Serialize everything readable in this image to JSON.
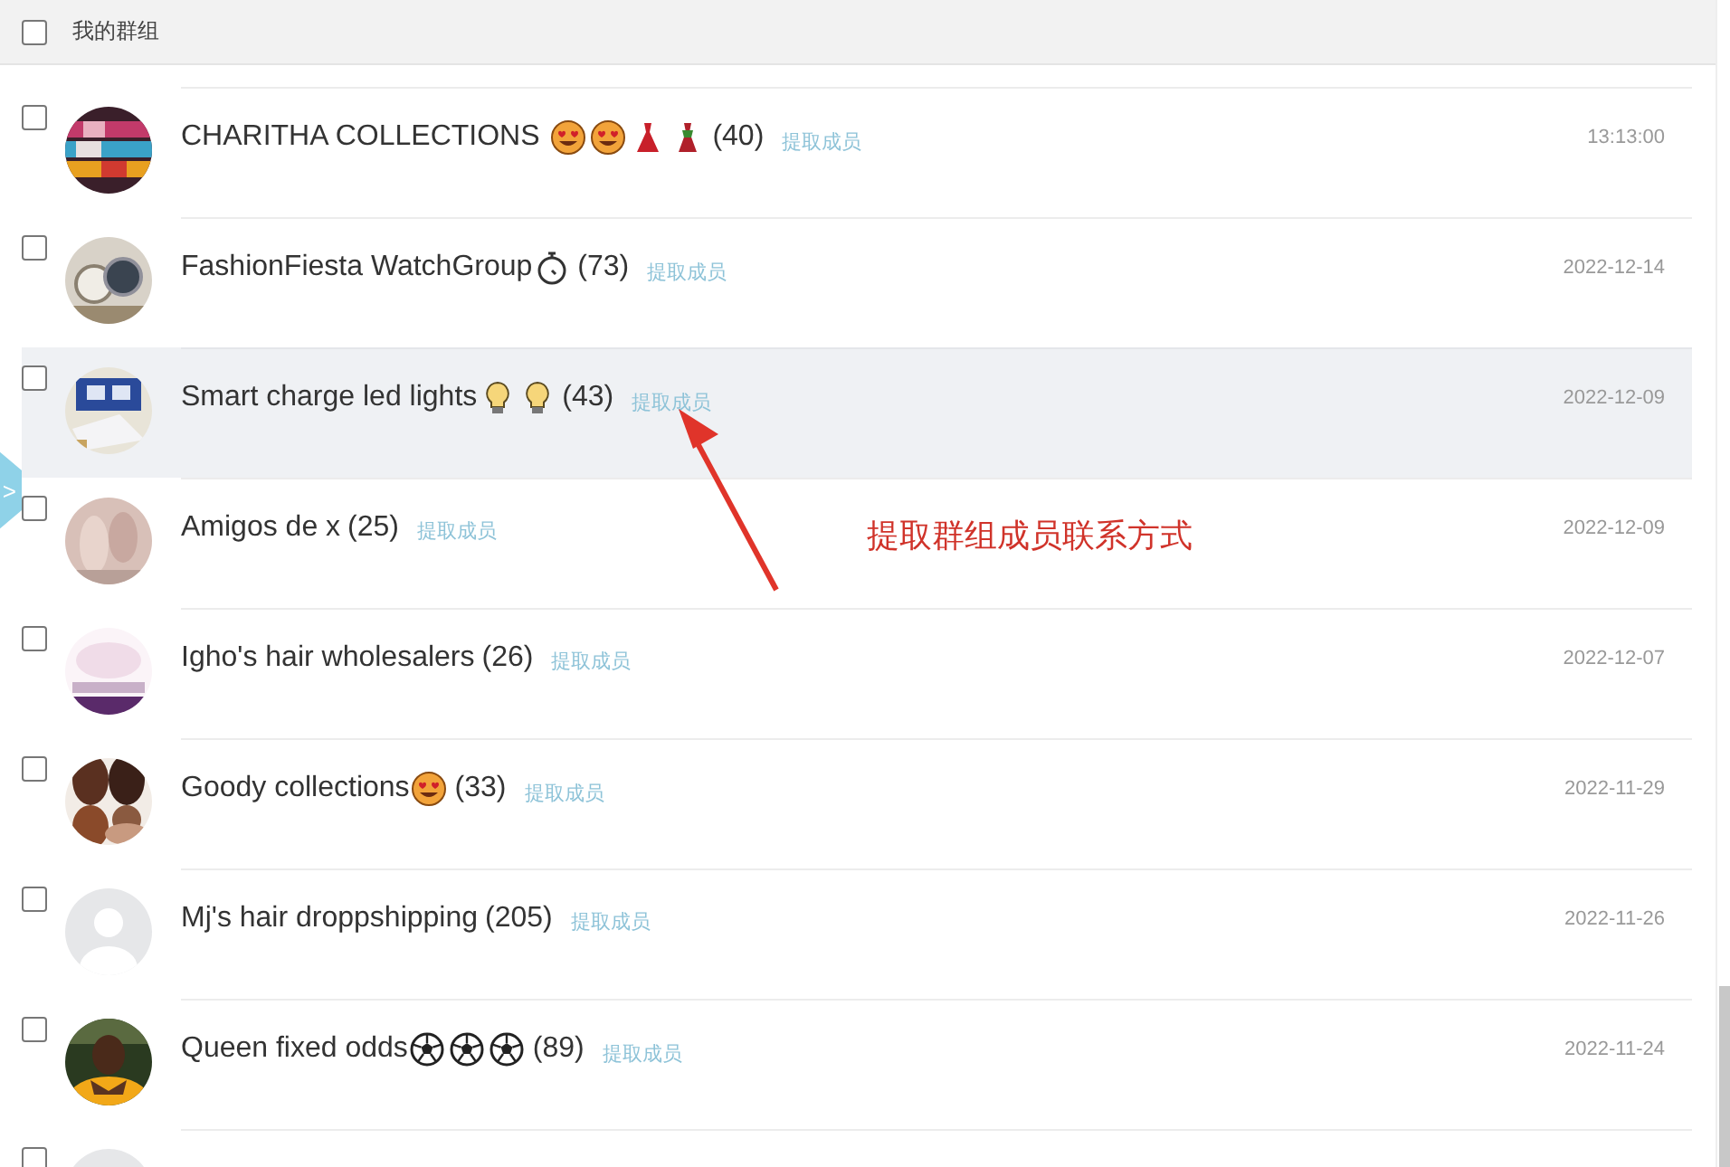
{
  "header": {
    "title": "我的群组",
    "checked": false
  },
  "rows": [
    {
      "checked": false,
      "selected": false,
      "avatar": {
        "kind": "picture"
      },
      "name": "CHARITHA COLLECTIONS ",
      "icons": [
        {
          "kind": "heart-eyes"
        },
        {
          "kind": "heart-eyes"
        },
        {
          "kind": "red-dress"
        },
        {
          "kind": "green-dress"
        }
      ],
      "count": "(40)",
      "action": "提取成员",
      "date": "13:13:00"
    },
    {
      "checked": false,
      "selected": false,
      "avatar": {
        "kind": "picture"
      },
      "name": "FashionFiesta WatchGroup",
      "icons": [
        {
          "kind": "stopwatch"
        }
      ],
      "count": "(73)",
      "action": "提取成员",
      "date": "2022-12-14"
    },
    {
      "checked": false,
      "selected": true,
      "avatar": {
        "kind": "picture"
      },
      "name": "Smart charge led lights",
      "icons": [
        {
          "kind": "bulb"
        },
        {
          "kind": "bulb"
        }
      ],
      "count": "(43)",
      "action": "提取成员",
      "date": "2022-12-09"
    },
    {
      "checked": false,
      "selected": false,
      "avatar": {
        "kind": "picture"
      },
      "name": "Amigos de x",
      "count": "(25)",
      "action": "提取成员",
      "date": "2022-12-09"
    },
    {
      "checked": false,
      "selected": false,
      "avatar": {
        "kind": "picture"
      },
      "name": "Igho's hair wholesalers",
      "count": "(26)",
      "action": "提取成员",
      "date": "2022-12-07"
    },
    {
      "checked": false,
      "selected": false,
      "avatar": {
        "kind": "picture"
      },
      "name": "Goody collections",
      "icons": [
        {
          "kind": "heart-eyes"
        }
      ],
      "count": "(33)",
      "action": "提取成员",
      "date": "2022-11-29"
    },
    {
      "checked": false,
      "selected": false,
      "avatar": {
        "kind": "default"
      },
      "name": "Mj's hair droppshipping",
      "count": "(205)",
      "action": "提取成员",
      "date": "2022-11-26"
    },
    {
      "checked": false,
      "selected": false,
      "avatar": {
        "kind": "picture"
      },
      "name": "Queen fixed odds",
      "icons": [
        {
          "kind": "soccer"
        },
        {
          "kind": "soccer"
        },
        {
          "kind": "soccer"
        }
      ],
      "count": "(89)",
      "action": "提取成员",
      "date": "2022-11-24"
    },
    {
      "checked": false,
      "selected": false,
      "avatar": {
        "kind": "default"
      }
    }
  ],
  "side_toggle": {
    "label": ">"
  },
  "annotation": {
    "text": "提取群组成员联系方式"
  }
}
